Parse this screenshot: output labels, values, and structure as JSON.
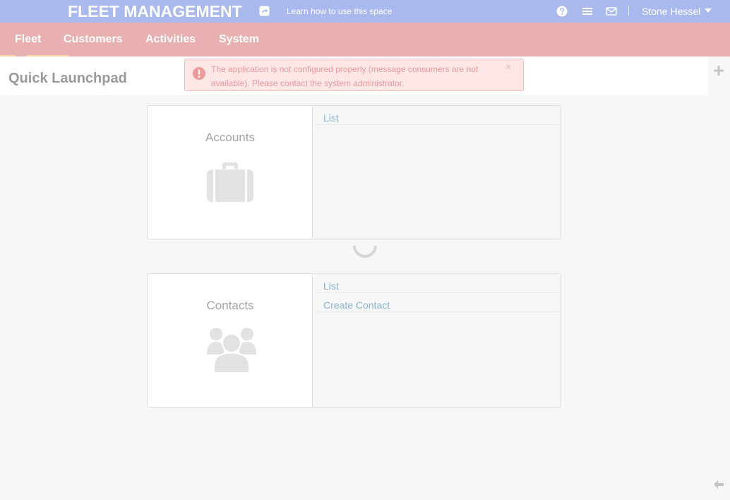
{
  "header": {
    "app_title": "FLEET MANAGEMENT",
    "share_icon": "share-icon",
    "help_link": "Learn how to use this space",
    "icons": [
      "question-circle-icon",
      "list-icon",
      "envelope-icon"
    ],
    "user_name": "Stone Hessel"
  },
  "nav": {
    "items": [
      {
        "label": "Fleet"
      },
      {
        "label": "Customers"
      },
      {
        "label": "Activities"
      },
      {
        "label": "System"
      }
    ]
  },
  "page": {
    "title": "Quick Launchpad"
  },
  "alert": {
    "message": "The application is not configured properly (message consumers are not available). Please contact the system administrator.",
    "close": "×"
  },
  "cards": [
    {
      "title": "Accounts",
      "icon": "briefcase-icon",
      "links": [
        "List"
      ]
    },
    {
      "title": "Contacts",
      "icon": "users-icon",
      "links": [
        "List",
        "Create Contact"
      ]
    }
  ],
  "colors": {
    "header_bg": "#a9b9ee",
    "nav_bg": "#e8b0b0",
    "alert_bg": "#fde6e6",
    "link": "#88b3cd"
  }
}
